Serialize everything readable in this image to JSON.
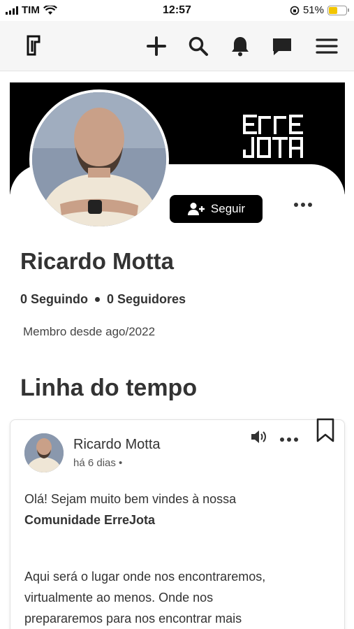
{
  "status_bar": {
    "carrier": "TIM",
    "time": "12:57",
    "battery_pct": "51%",
    "battery_level": 0.51,
    "battery_color": "#f2c500"
  },
  "header": {
    "logo_icon": "errejota-logo",
    "icons": [
      "plus-icon",
      "search-icon",
      "bell-icon",
      "chat-icon",
      "menu-icon"
    ]
  },
  "profile": {
    "brand_lines": [
      "ERRE",
      "JOTA"
    ],
    "follow_label": "Seguir",
    "name": "Ricardo Motta",
    "following": "0 Seguindo",
    "followers": "0 Seguidores",
    "member_since": "Membro desde ago/2022"
  },
  "timeline": {
    "title": "Linha do tempo",
    "post": {
      "author": "Ricardo Motta",
      "time": "há 6 dias •",
      "lines": [
        "Olá! Sejam muito bem vindes à nossa",
        "Comunidade ErreJota",
        "Aqui será o lugar onde nos encontraremos,",
        "virtualmente ao menos. Onde nos",
        "prepararemos para nos encontrar mais"
      ]
    }
  },
  "colors": {
    "accent": "#000000",
    "text": "#333333",
    "header_bg": "#f6f6f6"
  }
}
